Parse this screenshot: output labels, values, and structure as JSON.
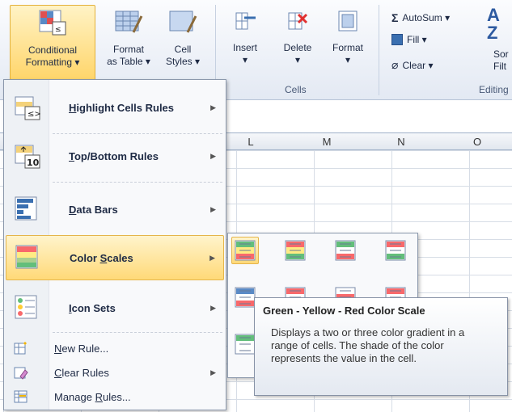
{
  "ribbon": {
    "conditional_formatting": {
      "line1": "Conditional",
      "line2": "Formatting ▾"
    },
    "format_as_table": {
      "line1": "Format",
      "line2": "as Table ▾"
    },
    "cell_styles": {
      "line1": "Cell",
      "line2": "Styles ▾"
    },
    "insert": {
      "label": "Insert",
      "arrow": "▾"
    },
    "delete": {
      "label": "Delete",
      "arrow": "▾"
    },
    "format": {
      "label": "Format",
      "arrow": "▾"
    },
    "cells_group": "Cells",
    "autosum": "AutoSum ▾",
    "fill": "Fill ▾",
    "clear": "Clear ▾",
    "sort_line1": "Sor",
    "sort_line2": "Filt",
    "editing_group": "Editing"
  },
  "columns": [
    "L",
    "M",
    "N",
    "O"
  ],
  "menu": {
    "items": [
      {
        "label": "Highlight Cells Rules",
        "underline": "H",
        "rest": "ighlight Cells Rules",
        "icon": "highlight-cells-icon"
      },
      {
        "label": "Top/Bottom Rules",
        "underline": "T",
        "rest": "op/Bottom Rules",
        "icon": "top-bottom-icon"
      },
      {
        "label": "Data Bars",
        "underline": "D",
        "rest": "ata Bars",
        "icon": "data-bars-icon"
      },
      {
        "label": "Color Scales",
        "pre": "Color ",
        "underline": "S",
        "rest": "cales",
        "icon": "color-scales-icon"
      },
      {
        "label": "Icon Sets",
        "underline": "I",
        "rest": "con Sets",
        "icon": "icon-sets-icon"
      }
    ],
    "new_rule": {
      "underline": "N",
      "rest": "ew Rule..."
    },
    "clear_rules": {
      "underline": "C",
      "rest": "lear Rules"
    },
    "manage_rules": {
      "pre": "Manage ",
      "underline": "R",
      "rest": "ules..."
    }
  },
  "tooltip": {
    "title": "Green - Yellow - Red Color Scale",
    "description": "Displays a two or three color gradient in a range of cells. The shade of the color represents the value in the cell."
  },
  "colors": {
    "highlight": "#ffd978",
    "green": "#63be7b",
    "yellow": "#ffeb84",
    "red": "#f8696b",
    "white": "#ffffff",
    "blue": "#5a8ac6"
  }
}
